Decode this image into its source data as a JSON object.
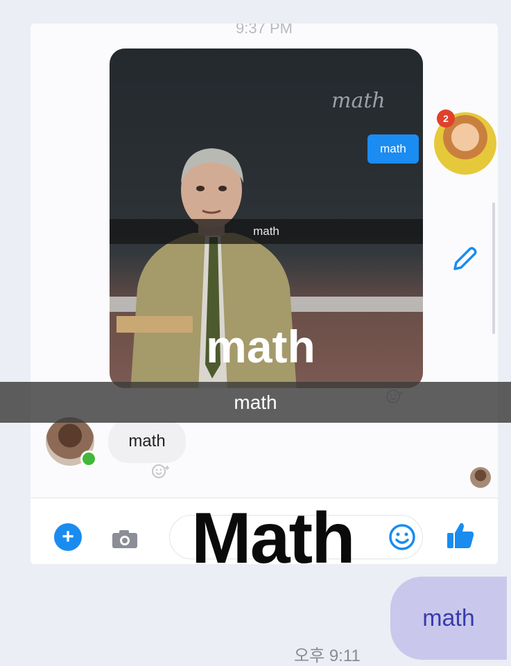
{
  "inner_screenshot": {
    "timestamp": "9:37 PM",
    "photo": {
      "chalk_text": "math",
      "blue_bubble_text": "math",
      "caption_small": "math",
      "caption_large": "math"
    },
    "right_avatar_badge": "2",
    "incoming_message": "math",
    "composer": {
      "overlay_text": "Math"
    }
  },
  "main_caption": "math",
  "sent_message": {
    "text": "math",
    "time": "오후 9:11"
  },
  "colors": {
    "messenger_blue": "#1b8cf2",
    "sent_bubble": "#c9c8ec",
    "sent_text": "#3a3ab0"
  }
}
